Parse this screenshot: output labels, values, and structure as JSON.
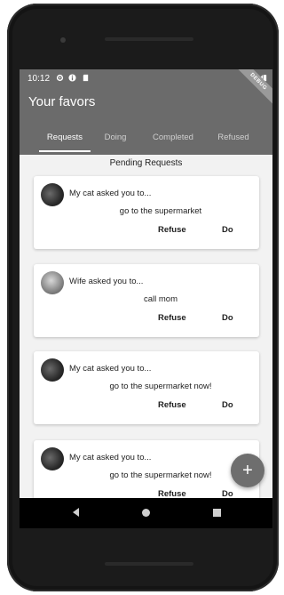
{
  "status_bar": {
    "time": "10:12",
    "right": "⁴◢▮"
  },
  "debug_banner": "DEBUG",
  "app": {
    "title": "Your favors"
  },
  "tabs": [
    {
      "label": "Requests",
      "active": true
    },
    {
      "label": "Doing",
      "active": false
    },
    {
      "label": "Completed",
      "active": false
    },
    {
      "label": "Refused",
      "active": false
    }
  ],
  "section_title": "Pending Requests",
  "favors": [
    {
      "asker": "My cat asked you to...",
      "task": "go to the supermarket",
      "refuse_label": "Refuse",
      "do_label": "Do"
    },
    {
      "asker": "Wife asked you to...",
      "task": "call mom",
      "refuse_label": "Refuse",
      "do_label": "Do"
    },
    {
      "asker": "My cat asked you to...",
      "task": "go to the supermarket now!",
      "refuse_label": "Refuse",
      "do_label": "Do"
    },
    {
      "asker": "My cat asked you to...",
      "task": "go to the supermarket now!",
      "refuse_label": "Refuse",
      "do_label": "Do"
    }
  ],
  "fab": {
    "icon": "plus-icon",
    "glyph": "+"
  },
  "nav": {
    "back": "back-icon",
    "home": "home-icon",
    "recents": "recents-icon"
  }
}
